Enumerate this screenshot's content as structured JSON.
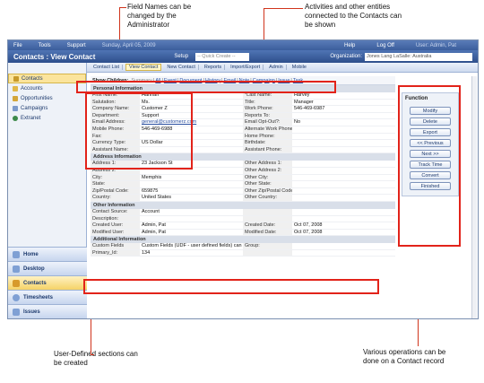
{
  "callouts": {
    "field_names": "Field Names can be changed by the Administrator",
    "activities": "Activities and other entities connected to the Contacts can be shown",
    "user_defined": "User-Defined sections can be created",
    "operations": "Various operations can be done on a Contact record"
  },
  "menubar": {
    "items": [
      "File",
      "Tools",
      "Support"
    ],
    "date": "Sunday, April 05, 2009",
    "help": "Help",
    "logoff": "Log Off",
    "user": "User: Admin, Pat"
  },
  "titlebar": {
    "title": "Contacts : View Contact",
    "setup": "Setup",
    "quick_create": "-- Quick Create --",
    "org_label": "Organization:",
    "org_value": "Jones Lang LaSalle: Australia"
  },
  "toolbar": {
    "items": [
      "Contact List",
      "View Contact",
      "New Contact",
      "Reports",
      "Import/Export",
      "Admin",
      "Mobile"
    ]
  },
  "sidebar": {
    "items": [
      "Contacts",
      "Accounts",
      "Opportunities",
      "Campaigns",
      "Extranet"
    ],
    "bottom": [
      "Home",
      "Desktop",
      "Contacts",
      "Timesheets",
      "Issues"
    ]
  },
  "show_children": {
    "label": "Show Children:",
    "links": [
      "Summary",
      "All",
      "Event",
      "Document",
      "History",
      "Email",
      "Note",
      "Campaign",
      "Issue",
      "Task"
    ]
  },
  "personal": {
    "header": "Personal Information",
    "rows": [
      [
        "First Name:",
        "Hannah",
        "*Last Name:",
        "Harvey"
      ],
      [
        "Salutation:",
        "Ms.",
        "Title:",
        "Manager"
      ],
      [
        "Company Name:",
        "Customer Z",
        "Work Phone:",
        "546-469-6987"
      ],
      [
        "Department:",
        "Support",
        "Reports To:",
        ""
      ],
      [
        "Email Address:",
        "general@customerz.com",
        "Email Opt-Out?:",
        "No"
      ],
      [
        "Mobile Phone:",
        "546-469-6988",
        "Alternate Work Phone:",
        ""
      ],
      [
        "Fax:",
        "",
        "Home Phone:",
        ""
      ],
      [
        "Currency Type:",
        "US Dollar",
        "Birthdate:",
        ""
      ],
      [
        "Assistant Name:",
        "",
        "Assistant Phone:",
        ""
      ]
    ]
  },
  "address": {
    "header": "Address Information",
    "rows": [
      [
        "Address 1:",
        "23 Jackson St",
        "Other Address 1:",
        ""
      ],
      [
        "Address 2:",
        "",
        "Other Address 2:",
        ""
      ],
      [
        "City:",
        "Memphis",
        "Other City:",
        ""
      ],
      [
        "State:",
        "",
        "Other State:",
        ""
      ],
      [
        "Zip/Postal Code:",
        "659875",
        "Other Zip/Postal Code:",
        ""
      ],
      [
        "Country:",
        "United States",
        "Other Country:",
        ""
      ]
    ]
  },
  "other": {
    "header": "Other Information",
    "rows": [
      [
        "Contact Source:",
        "Account",
        "",
        ""
      ],
      [
        "Description:",
        "",
        "",
        ""
      ],
      [
        "Created User:",
        "Admin, Pat",
        "Created Date:",
        "Oct 07, 2008"
      ],
      [
        "Modified User:",
        "Admin, Pat",
        "Modified Date:",
        "Oct 07, 2008"
      ]
    ]
  },
  "additional": {
    "header": "Additional Information",
    "rows": [
      [
        "Custom Fields",
        "Custom Fields (UDF - user defined fields) can be created by Administrators.",
        "Group:",
        ""
      ],
      [
        "Primary_Id:",
        "134",
        "",
        ""
      ]
    ]
  },
  "functions": {
    "header": "Function",
    "buttons": [
      "Modify",
      "Delete",
      "Export",
      "<< Previous",
      "Next >>",
      "Track Time",
      "Convert",
      "Finished"
    ]
  }
}
